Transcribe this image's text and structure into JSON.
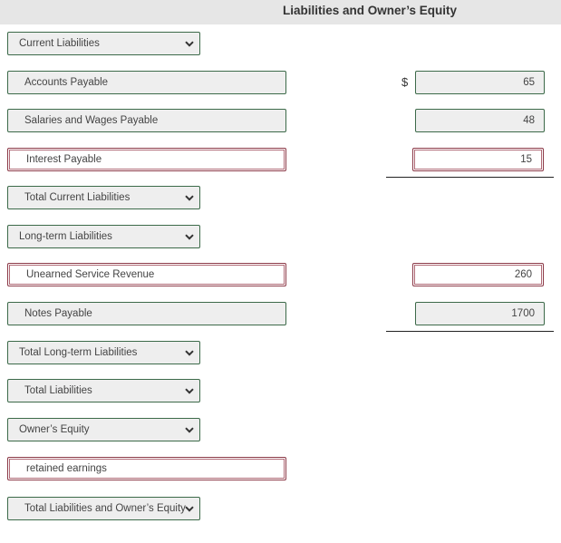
{
  "header": {
    "title": "Liabilities and Owner’s Equity"
  },
  "currency_symbol": "$",
  "rows": [
    {
      "type": "select",
      "label": "Current Liabilities"
    },
    {
      "type": "account",
      "label": "Accounts Payable",
      "amount": "65",
      "status": "ok"
    },
    {
      "type": "account",
      "label": "Salaries and Wages Payable",
      "amount": "48",
      "status": "ok"
    },
    {
      "type": "account",
      "label": "Interest Payable",
      "amount": "15",
      "status": "error"
    },
    {
      "type": "select",
      "label": "Total Current Liabilities"
    },
    {
      "type": "select",
      "label": "Long-term Liabilities"
    },
    {
      "type": "account",
      "label": "Unearned Service Revenue",
      "amount": "260",
      "status": "error"
    },
    {
      "type": "account",
      "label": "Notes Payable",
      "amount": "1700",
      "status": "ok"
    },
    {
      "type": "select",
      "label": "Total Long-term Liabilities"
    },
    {
      "type": "select",
      "label": "Total Liabilities"
    },
    {
      "type": "select",
      "label": "Owner’s Equity"
    },
    {
      "type": "account",
      "label": "retained earnings",
      "amount": "",
      "status": "error"
    },
    {
      "type": "select",
      "label": "Total Liabilities and Owner’s Equity"
    }
  ],
  "colors": {
    "ok_border": "#3c6a49",
    "error_border": "#8c3a48",
    "field_bg": "#eeeeee",
    "header_bg": "#e6e6e6"
  }
}
